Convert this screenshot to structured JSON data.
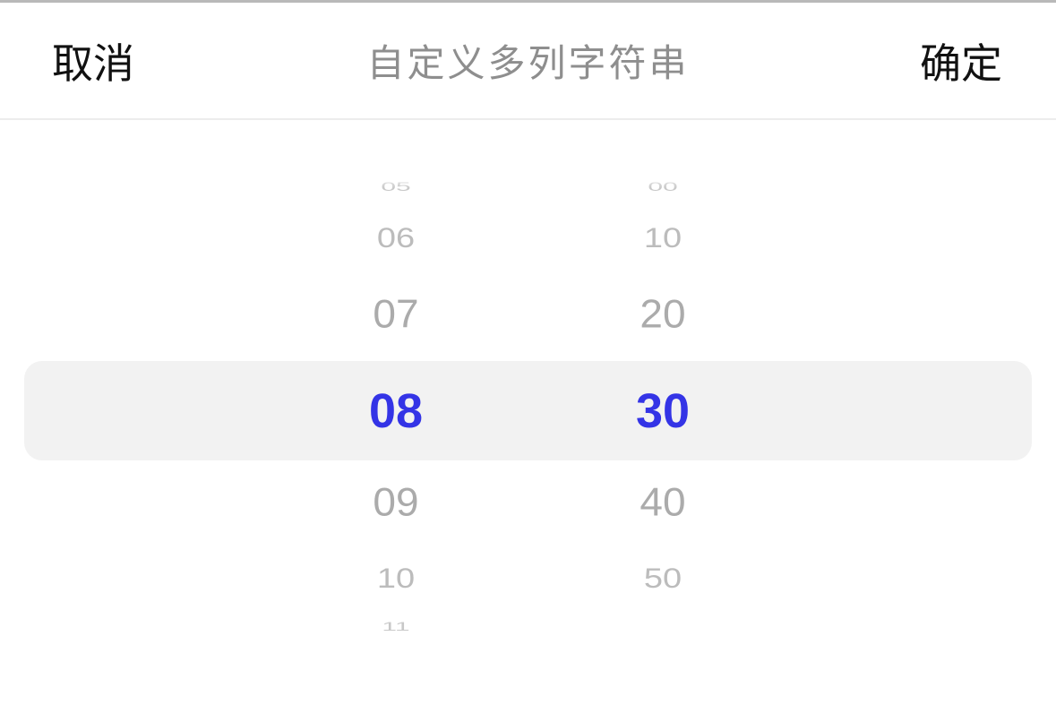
{
  "toolbar": {
    "cancel_label": "取消",
    "title": "自定义多列字符串",
    "confirm_label": "确定"
  },
  "picker": {
    "hours": {
      "items": [
        "05",
        "06",
        "07",
        "08",
        "09",
        "10",
        "11"
      ],
      "selected": "08"
    },
    "minutes": {
      "items": [
        "00",
        "10",
        "20",
        "30",
        "40",
        "50"
      ],
      "selected": "30"
    },
    "colors": {
      "selected": "#3434e6",
      "unselected": "#ababab",
      "highlight_band": "#f2f2f2"
    }
  }
}
